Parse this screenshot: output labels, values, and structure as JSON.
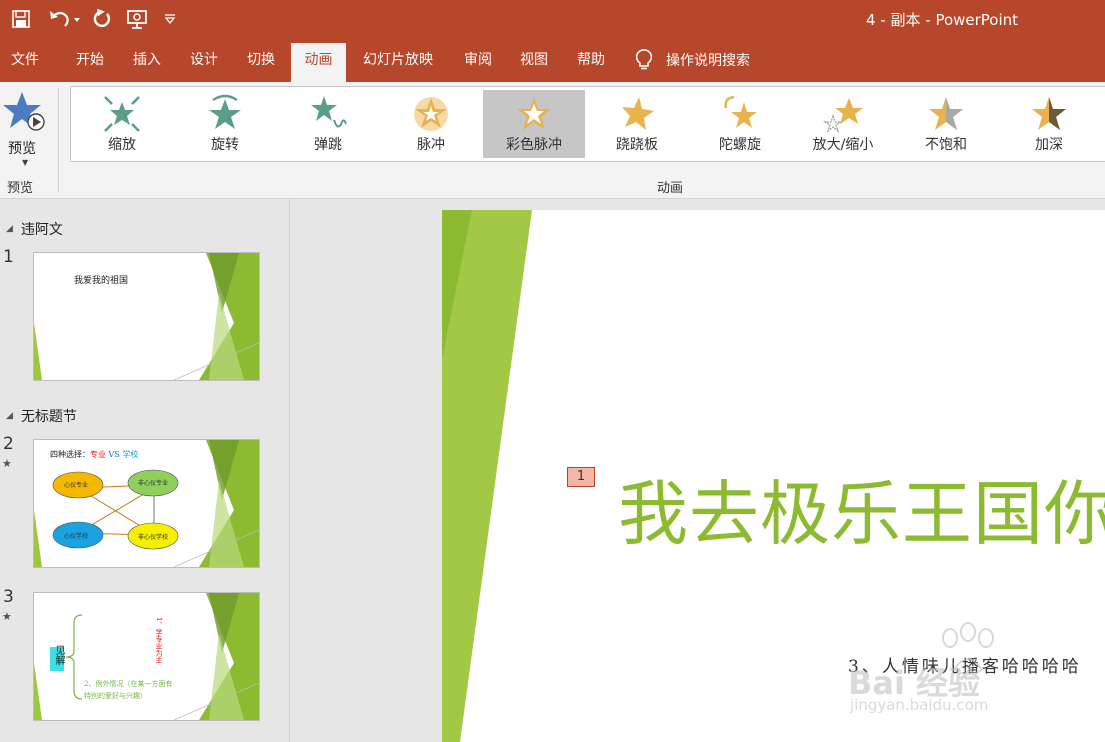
{
  "app": {
    "title": "4 - 副本  -  PowerPoint"
  },
  "colors": {
    "accent": "#b7472a",
    "slide_green": "#8cbb32",
    "star_teal": "#5a9e86",
    "star_gold": "#e8b24c"
  },
  "quick_access": [
    "save-icon",
    "undo-icon",
    "redo-icon",
    "present-icon",
    "customize-icon"
  ],
  "menu": {
    "tabs": [
      {
        "label": "文件"
      },
      {
        "label": "开始"
      },
      {
        "label": "插入"
      },
      {
        "label": "设计"
      },
      {
        "label": "切换"
      },
      {
        "label": "动画"
      },
      {
        "label": "幻灯片放映"
      },
      {
        "label": "审阅"
      },
      {
        "label": "视图"
      },
      {
        "label": "帮助"
      }
    ],
    "active": "动画",
    "search_label": "操作说明搜索"
  },
  "ribbon": {
    "preview": {
      "label": "预览",
      "group_label": "预览"
    },
    "animation_group_label": "动画",
    "animations": [
      {
        "label": "缩放",
        "icon": "zoom-star-icon"
      },
      {
        "label": "旋转",
        "icon": "rotate-star-icon"
      },
      {
        "label": "弹跳",
        "icon": "bounce-star-icon"
      },
      {
        "label": "脉冲",
        "icon": "pulse-star-icon"
      },
      {
        "label": "彩色脉冲",
        "icon": "color-pulse-star-icon",
        "selected": true
      },
      {
        "label": "跷跷板",
        "icon": "teeter-star-icon"
      },
      {
        "label": "陀螺旋",
        "icon": "spin-star-icon"
      },
      {
        "label": "放大/缩小",
        "icon": "grow-shrink-star-icon"
      },
      {
        "label": "不饱和",
        "icon": "desaturate-star-icon"
      },
      {
        "label": "加深",
        "icon": "darken-star-icon"
      }
    ]
  },
  "slides_panel": {
    "sections": [
      {
        "label": "违阿文"
      },
      {
        "label": "无标题节"
      }
    ],
    "slides": [
      {
        "number": "1",
        "has_animation": false,
        "title": "我爱我的祖国"
      },
      {
        "number": "2",
        "has_animation": true,
        "title_black": "四种选择：",
        "title_red": "专业",
        "title_vs": " VS ",
        "title_blue": "学校",
        "nodes": [
          "心仪专业",
          "非心仪专业",
          "心仪学校",
          "非心仪学校"
        ]
      },
      {
        "number": "3",
        "has_animation": true,
        "box_label": "见解",
        "line1": "1、学专业为主",
        "line2": "2、例外情况（在某一方面有",
        "line3": "特别的爱好与兴趣）"
      }
    ],
    "star_indicator": "★"
  },
  "main_slide": {
    "animation_tag": "1",
    "title": "我去极乐王国你",
    "subtitle": "3、人情味儿播客哈哈哈哈"
  },
  "watermark": {
    "brand": "Bai 经验",
    "url": "jingyan.baidu.com"
  }
}
